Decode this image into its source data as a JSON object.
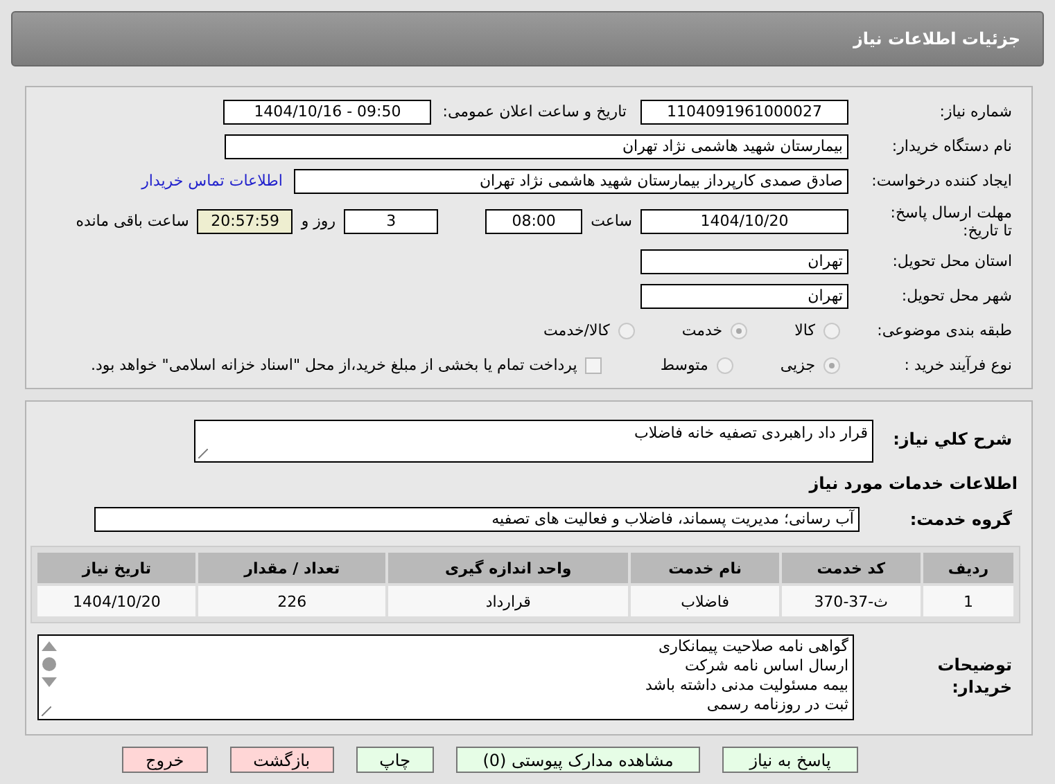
{
  "title": "جزئیات اطلاعات نیاز",
  "need_number": {
    "label": "شماره نیاز:",
    "value": "1104091961000027"
  },
  "announce": {
    "label": "تاریخ و ساعت اعلان عمومی:",
    "value": "1404/10/16 - 09:50"
  },
  "buyer": {
    "label": "نام دستگاه خریدار:",
    "value": "بیمارستان شهید هاشمی نژاد تهران"
  },
  "creator": {
    "label": "ایجاد کننده درخواست:",
    "value": "صادق صمدی کارپرداز بیمارستان شهید هاشمی نژاد تهران",
    "link": "اطلاعات تماس خریدار"
  },
  "deadline": {
    "label": "مهلت ارسال پاسخ: تا تاریخ:",
    "date": "1404/10/20",
    "time_label": "ساعت",
    "time": "08:00",
    "days": "3",
    "days_label": "روز و",
    "remaining": "20:57:59",
    "remaining_label": "ساعت باقی مانده"
  },
  "province": {
    "label": "استان محل تحویل:",
    "value": "تهران"
  },
  "city": {
    "label": "شهر محل تحویل:",
    "value": "تهران"
  },
  "category": {
    "label": "طبقه بندی موضوعی:",
    "options": [
      {
        "label": "کالا",
        "selected": false
      },
      {
        "label": "خدمت",
        "selected": true
      },
      {
        "label": "کالا/خدمت",
        "selected": false
      }
    ]
  },
  "process": {
    "label": "نوع فرآیند خرید :",
    "options": [
      {
        "label": "جزیی",
        "selected": true
      },
      {
        "label": "متوسط",
        "selected": false
      }
    ],
    "payment": {
      "label": "پرداخت تمام یا بخشی از مبلغ خرید،از محل \"اسناد خزانه اسلامی\" خواهد بود.",
      "checked": false
    }
  },
  "description": {
    "label": "شرح كلي نياز:",
    "value": "قرار داد راهبردی تصفیه خانه فاضلاب"
  },
  "services_heading": "اطلاعات خدمات مورد نیاز",
  "service_group": {
    "label": "گروه خدمت:",
    "value": "آب رسانی؛ مدیریت پسماند، فاضلاب و فعالیت های تصفیه"
  },
  "table": {
    "columns": [
      "ردیف",
      "کد خدمت",
      "نام خدمت",
      "واحد اندازه گیری",
      "تعداد / مقدار",
      "تاریخ نیاز"
    ],
    "rows": [
      [
        "1",
        "ث-37-370",
        "فاضلاب",
        "قرارداد",
        "226",
        "1404/10/20"
      ]
    ]
  },
  "notes": {
    "label": "توضیحات خریدار:",
    "lines": [
      "گواهی نامه صلاحیت پیمانکاری",
      "ارسال اساس نامه شرکت",
      "بیمه مسئولیت مدنی داشته باشد",
      "ثبت در روزنامه رسمی"
    ]
  },
  "buttons": [
    {
      "label": "پاسخ به نیاز",
      "kind": "normal"
    },
    {
      "label": "مشاهده مدارک پیوستی (0)",
      "kind": "normal"
    },
    {
      "label": "چاپ",
      "kind": "normal"
    },
    {
      "label": "بازگشت",
      "kind": "danger"
    },
    {
      "label": "خروج",
      "kind": "danger"
    }
  ]
}
